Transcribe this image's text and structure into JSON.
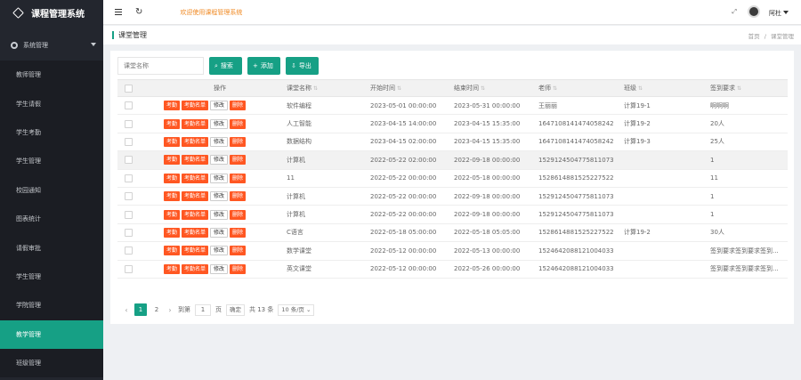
{
  "app": {
    "title": "课程管理系统",
    "welcome": "欢迎使用课程管理系统",
    "username": "阿杜"
  },
  "sidebar": {
    "group_label": "系统管理",
    "items": [
      {
        "label": "教师管理"
      },
      {
        "label": "学生请假"
      },
      {
        "label": "学生考勤"
      },
      {
        "label": "学生管理"
      },
      {
        "label": "校园通知"
      },
      {
        "label": "图表统计"
      },
      {
        "label": "请假审批"
      },
      {
        "label": "学生管理"
      },
      {
        "label": "学院管理"
      },
      {
        "label": "教学管理"
      },
      {
        "label": "班级管理"
      }
    ],
    "active_index": 9
  },
  "breadcrumb": {
    "title": "课堂管理",
    "home": "首页",
    "sep": "/",
    "current": "课堂管理"
  },
  "toolbar": {
    "search_placeholder": "课堂名称",
    "search_label": "搜索",
    "add_label": "添加",
    "export_label": "导出"
  },
  "table": {
    "headers": {
      "action": "操作",
      "name": "课堂名称",
      "start": "开始时间",
      "end": "结束时间",
      "teacher": "老师",
      "class": "班级",
      "req": "签到要求"
    },
    "action_labels": {
      "attend": "考勤",
      "attend_list": "考勤名单",
      "edit": "修改",
      "delete": "删除"
    },
    "rows": [
      {
        "name": "软件编程",
        "start": "2023-05-01 00:00:00",
        "end": "2023-05-31 00:00:00",
        "teacher": "王丽丽",
        "class": "计算19-1",
        "req": "啊啊啊"
      },
      {
        "name": "人工智能",
        "start": "2023-04-15 14:00:00",
        "end": "2023-04-15 15:35:00",
        "teacher": "1647108141474058242",
        "class": "计算19-2",
        "req": "20人"
      },
      {
        "name": "数据结构",
        "start": "2023-04-15 02:00:00",
        "end": "2023-04-15 15:35:00",
        "teacher": "1647108141474058242",
        "class": "计算19-3",
        "req": "25人"
      },
      {
        "name": "计算机",
        "start": "2022-05-22 02:00:00",
        "end": "2022-09-18 00:00:00",
        "teacher": "1529124504775811073",
        "class": "",
        "req": "1"
      },
      {
        "name": "11",
        "start": "2022-05-22 00:00:00",
        "end": "2022-05-18 00:00:00",
        "teacher": "1528614881525227522",
        "class": "",
        "req": "11"
      },
      {
        "name": "计算机",
        "start": "2022-05-22 00:00:00",
        "end": "2022-09-18 00:00:00",
        "teacher": "1529124504775811073",
        "class": "",
        "req": "1"
      },
      {
        "name": "计算机",
        "start": "2022-05-22 00:00:00",
        "end": "2022-09-18 00:00:00",
        "teacher": "1529124504775811073",
        "class": "",
        "req": "1"
      },
      {
        "name": "C语言",
        "start": "2022-05-18 05:00:00",
        "end": "2022-05-18 05:05:00",
        "teacher": "1528614881525227522",
        "class": "计算19-2",
        "req": "30人"
      },
      {
        "name": "数学课堂",
        "start": "2022-05-12 00:00:00",
        "end": "2022-05-13 00:00:00",
        "teacher": "1524642088121004033",
        "class": "",
        "req": "签到要求签到要求签到..."
      },
      {
        "name": "英文课堂",
        "start": "2022-05-12 00:00:00",
        "end": "2022-05-26 00:00:00",
        "teacher": "1524642088121004033",
        "class": "",
        "req": "签到要求签到要求签到..."
      }
    ],
    "highlight_row": 3
  },
  "pager": {
    "current": "1",
    "page2": "2",
    "goto_label": "到第",
    "input_value": "1",
    "page_unit": "页",
    "confirm": "确定",
    "total": "共 13 条",
    "size": "10 条/页"
  }
}
